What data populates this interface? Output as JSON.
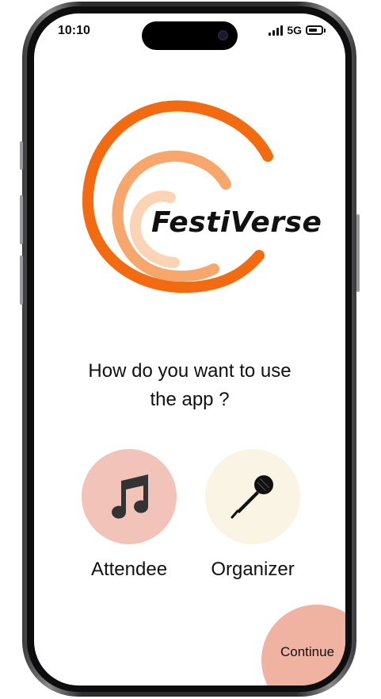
{
  "status_bar": {
    "time": "10:10",
    "network": "5G",
    "battery_level": 0.7
  },
  "app": {
    "brand_name": "FestiVerse"
  },
  "prompt": {
    "line1": "How do you want to use",
    "line2": "the app ?"
  },
  "roles": [
    {
      "label": "Attendee",
      "icon": "music-note-icon",
      "color": "#f2c3b8"
    },
    {
      "label": "Organizer",
      "icon": "microphone-icon",
      "color": "#f9f4e3"
    }
  ],
  "actions": {
    "continue_label": "Continue",
    "continue_color": "#f0b3a2"
  },
  "colors": {
    "logo_dark": "#f36b10",
    "logo_mid": "#f7a66c",
    "logo_light": "#fbd3b5"
  }
}
